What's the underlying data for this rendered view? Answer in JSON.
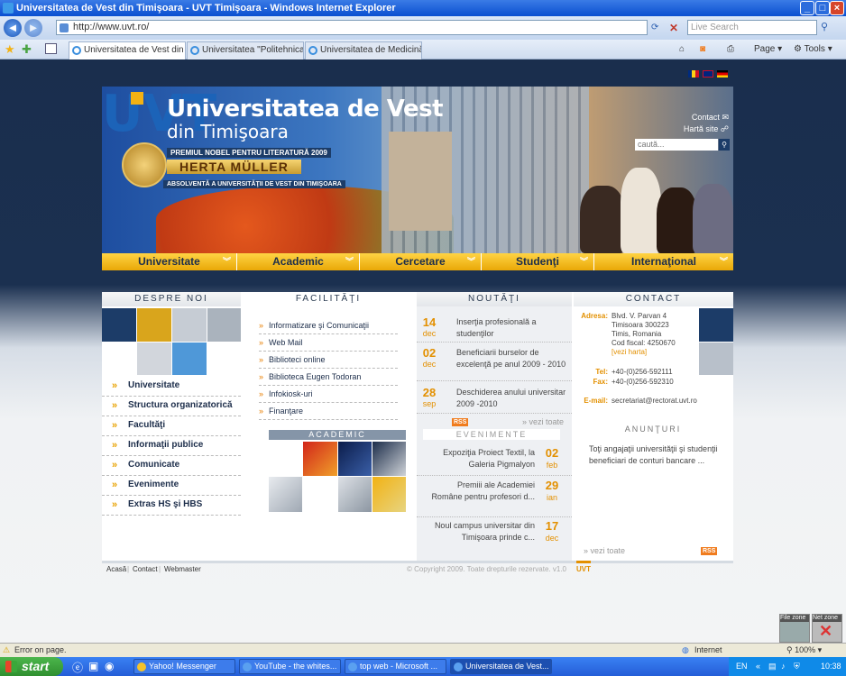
{
  "window": {
    "title": "Universitatea de Vest din Timişoara - UVT Timişoara - Windows Internet Explorer"
  },
  "browser": {
    "url": "http://www.uvt.ro/",
    "search_placeholder": "Live Search",
    "tabs": [
      {
        "label": "Universitatea de Vest din ...",
        "active": true
      },
      {
        "label": "Universitatea \"Politehnica\" Ti...",
        "active": false
      },
      {
        "label": "Universitatea de Medicină şi ...",
        "active": false
      }
    ],
    "toolbar": {
      "page_label": "Page",
      "tools_label": "Tools"
    }
  },
  "header": {
    "logo_mark": "UVT",
    "logo_line1": "Universitatea de Vest",
    "logo_line2": "din Timişoara",
    "nobel_line1": "PREMIUL NOBEL PENTRU LITERATURĂ 2009",
    "nobel_name": "HERTA MÜLLER",
    "nobel_line3": "ABSOLVENTĂ A UNIVERSITĂŢII DE VEST DIN TIMIŞOARA",
    "links": [
      "Contact",
      "Hartă site"
    ],
    "search_placeholder": "caută..."
  },
  "nav": [
    "Universitate",
    "Academic",
    "Cercetare",
    "Studenţi",
    "Internaţional"
  ],
  "sections": {
    "despre": "DESPRE NOI",
    "facilitati": "FACILITĂŢI",
    "noutati": "NOUTĂŢI",
    "contact": "CONTACT",
    "academic": "ACADEMIC",
    "evenimente": "EVENIMENTE",
    "anunturi": "ANUNŢURI"
  },
  "left_links": [
    "Universitate",
    "Structura organizatorică",
    "Facultăţi",
    "Informaţii publice",
    "Comunicate",
    "Evenimente",
    "Extras HS şi HBS"
  ],
  "facilities": [
    "Informatizare şi Comunicaţii",
    "Web Mail",
    "Biblioteci online",
    "Biblioteca Eugen Todoran",
    "Infokiosk-uri",
    "Finanţare"
  ],
  "news": [
    {
      "day": "14",
      "month": "dec",
      "text": "Inserţia profesională a studenţilor"
    },
    {
      "day": "02",
      "month": "dec",
      "text": "Beneficiarii burselor de excelenţă pe anul 2009 - 2010"
    },
    {
      "day": "28",
      "month": "sep",
      "text": "Deschiderea anului universitar 2009 -2010"
    }
  ],
  "news_more": "» vezi toate",
  "events": [
    {
      "day": "02",
      "month": "feb",
      "text": "Expoziţia Proiect Textil, la Galeria Pigmalyon"
    },
    {
      "day": "29",
      "month": "ian",
      "text": "Premiii ale Academiei Române pentru profesori d..."
    },
    {
      "day": "17",
      "month": "dec",
      "text": "Noul campus universitar din Timişoara prinde c..."
    }
  ],
  "contact": {
    "adresa_label": "Adresa:",
    "adresa": [
      "Blvd. V. Parvan 4",
      "Timisoara 300223",
      "Timis, Romania",
      "Cod fiscal: 4250670"
    ],
    "harta": "[vezi harta]",
    "tel_label": "Tel:",
    "tel": "+40-(0)256-592111",
    "fax_label": "Fax:",
    "fax": "+40-(0)256-592310",
    "email_label": "E-mail:",
    "email": "secretariat@rectorat.uvt.ro"
  },
  "anunturi_text": "Toţi angajaţii universităţii şi studenţii beneficiari de conturi bancare ...",
  "anunturi_more": "» vezi toate",
  "rss": "RSS",
  "footer": {
    "links": [
      "Acasă",
      "Contact",
      "Webmaster"
    ],
    "copyright": "© Copyright 2009. Toate drepturile rezervate. v1.0",
    "uvt": "UVT"
  },
  "status": {
    "text": "Error on page.",
    "zone": "Internet",
    "zoom": "100%"
  },
  "zonebox": {
    "file": "File zone",
    "net": "Net zone"
  },
  "taskbar": {
    "start": "start",
    "tasks": [
      "Yahoo! Messenger",
      "YouTube - the whites...",
      "top web - Microsoft ...",
      "Universitatea de Vest..."
    ],
    "lang": "EN",
    "clock": "10:38"
  },
  "colors": {
    "accent": "#e9a807",
    "navy": "#1c2d4a",
    "orange": "#e39000"
  }
}
